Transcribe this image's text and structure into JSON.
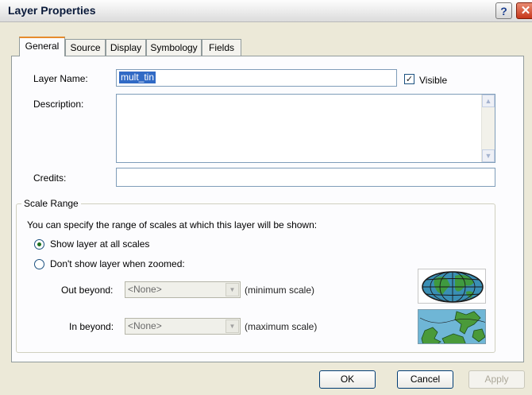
{
  "window": {
    "title": "Layer Properties"
  },
  "tabs": [
    "General",
    "Source",
    "Display",
    "Symbology",
    "Fields"
  ],
  "general": {
    "layer_name_label": "Layer Name:",
    "layer_name_value": "mult_tin",
    "visible_label": "Visible",
    "visible_checked": true,
    "description_label": "Description:",
    "description_value": "",
    "credits_label": "Credits:",
    "credits_value": ""
  },
  "scale_range": {
    "title": "Scale Range",
    "intro": "You can specify the range of scales at which this layer will be shown:",
    "option_all": "Show layer at all scales",
    "option_zoomed": "Don't show layer when zoomed:",
    "selected_option": "all",
    "out_beyond_label": "Out beyond:",
    "out_beyond_value": "<None>",
    "out_beyond_hint": "(minimum scale)",
    "in_beyond_label": "In beyond:",
    "in_beyond_value": "<None>",
    "in_beyond_hint": "(maximum scale)"
  },
  "buttons": {
    "ok": "OK",
    "cancel": "Cancel",
    "apply": "Apply"
  },
  "colors": {
    "selection": "#316ac5",
    "dialog_bg": "#ece9d8",
    "panel_bg": "#fcfcfe",
    "close": "#c6371b"
  },
  "icons": [
    "help-icon",
    "close-icon",
    "scroll-up-icon",
    "scroll-down-icon",
    "dropdown-arrow-icon",
    "globe-scale-icon",
    "map-scale-icon"
  ]
}
